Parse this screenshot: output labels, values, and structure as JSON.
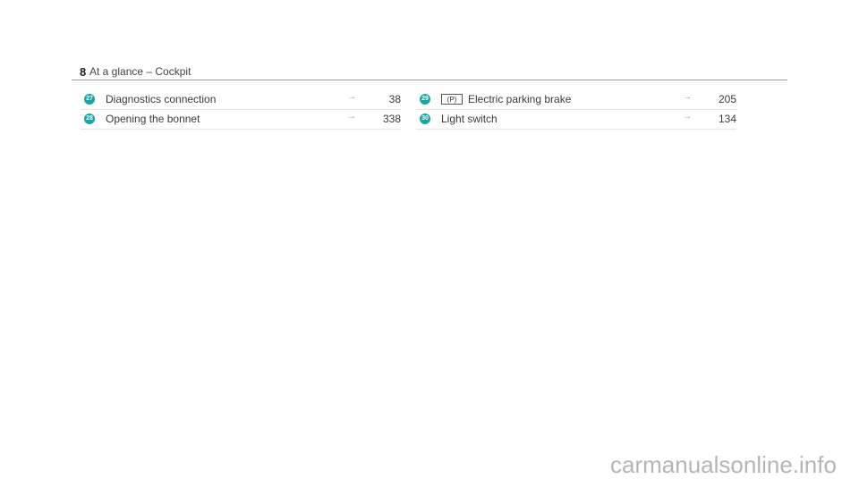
{
  "header": {
    "page_number": "8",
    "title": "At a glance – Cockpit"
  },
  "left_column": [
    {
      "number": "27",
      "label": "Diagnostics connection",
      "arrow": "→",
      "page": "38"
    },
    {
      "number": "28",
      "label": "Opening the bonnet",
      "arrow": "→",
      "page": "338"
    }
  ],
  "right_column": [
    {
      "number": "29",
      "icon": "(P)",
      "label": "Electric parking brake",
      "arrow": "→",
      "page": "205"
    },
    {
      "number": "30",
      "label": "Light switch",
      "arrow": "→",
      "page": "134"
    }
  ],
  "watermark": "carmanualsonline.info",
  "colors": {
    "badge": "#1fa3a0",
    "rule": "#8fa39c"
  }
}
